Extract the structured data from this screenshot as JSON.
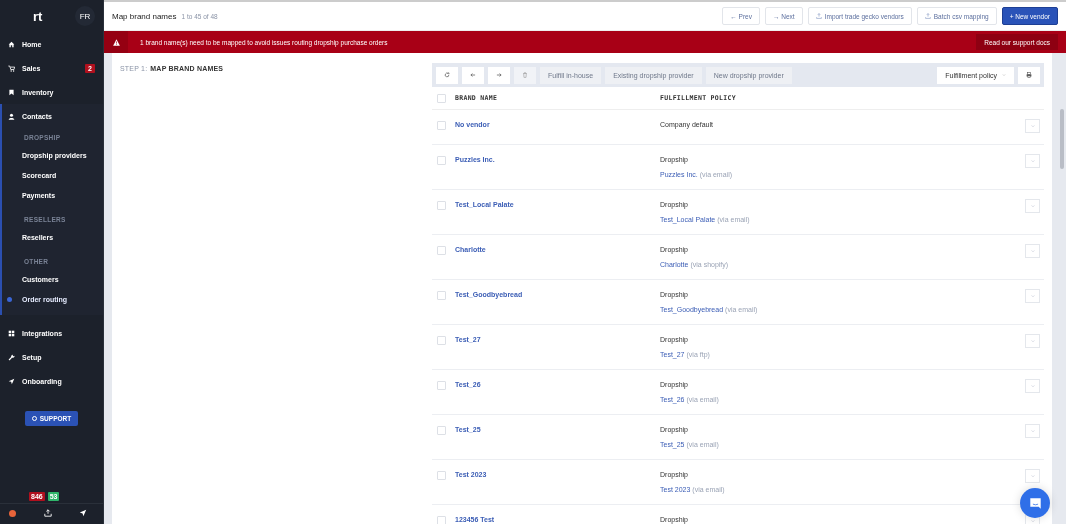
{
  "app": {
    "logo_text": "rt",
    "language": "FR"
  },
  "sidebar": {
    "items": [
      {
        "label": "Home",
        "selected": false
      },
      {
        "label": "Sales",
        "badge": "2",
        "selected": false
      },
      {
        "label": "Inventory",
        "selected": false
      },
      {
        "label": "Contacts",
        "selected": false,
        "expanded": true,
        "children": [
          {
            "kind": "heading",
            "label": "DROPSHIP"
          },
          {
            "kind": "link",
            "label": "Dropship providers",
            "selected": false
          },
          {
            "kind": "link",
            "label": "Scorecard",
            "selected": false
          },
          {
            "kind": "link",
            "label": "Payments",
            "selected": false
          },
          {
            "kind": "heading",
            "label": "RESELLERS"
          },
          {
            "kind": "link",
            "label": "Resellers",
            "selected": false
          },
          {
            "kind": "heading",
            "label": "OTHER"
          },
          {
            "kind": "link",
            "label": "Customers",
            "selected": false
          },
          {
            "kind": "link",
            "label": "Order routing",
            "selected": true
          }
        ]
      },
      {
        "label": "Integrations",
        "selected": false
      },
      {
        "label": "Setup",
        "selected": false
      },
      {
        "label": "Onboarding",
        "selected": false
      }
    ],
    "support_button": "SUPPORT",
    "counters": [
      {
        "label": "846",
        "color": "#b0101e"
      },
      {
        "label": "53",
        "color": "#2fb56a"
      }
    ]
  },
  "header": {
    "title": "Map brand names",
    "count": "1 to 45 of 48",
    "buttons": [
      {
        "kind": "plain",
        "label": "← Prev"
      },
      {
        "kind": "plain",
        "label": "→ Next"
      },
      {
        "kind": "upload",
        "label": "Import trade gecko vendors"
      },
      {
        "kind": "upload",
        "label": "Batch csv mapping"
      },
      {
        "kind": "primary",
        "label": "+ New vendor"
      }
    ]
  },
  "alert": {
    "message": "1 brand name(s) need to be mapped to avoid issues routing dropship purchase orders",
    "action": "Read our support docs"
  },
  "step": {
    "number": "STEP 1:",
    "title": "MAP BRAND NAMES"
  },
  "toolbar": {
    "buttons": [
      {
        "kind": "refresh"
      },
      {
        "kind": "back"
      },
      {
        "kind": "forward"
      },
      {
        "kind": "delete"
      },
      {
        "kind": "text",
        "label": "Fulfill in-house",
        "disabled": true
      },
      {
        "kind": "text",
        "label": "Existing dropship provider",
        "disabled": true
      },
      {
        "kind": "text",
        "label": "New dropship provider",
        "disabled": true
      }
    ],
    "filter": "Fulfillment policy"
  },
  "table": {
    "select_all": {
      "checked": false
    },
    "columns": [
      "BRAND NAME",
      "FULFILLMENT POLICY"
    ],
    "rows": [
      {
        "name": "No vendor",
        "checked": false,
        "policy": "Company default"
      },
      {
        "name": "Puzzles Inc.",
        "checked": false,
        "policy": "Dropship",
        "provider": "Puzzles Inc.",
        "via": "(via email)"
      },
      {
        "name": "Test_Local Palate",
        "checked": false,
        "policy": "Dropship",
        "provider": "Test_Local Palate",
        "via": "(via email)"
      },
      {
        "name": "Charlotte",
        "checked": false,
        "policy": "Dropship",
        "provider": "Charlotte",
        "via": "(via shopify)"
      },
      {
        "name": "Test_Goodbyebread",
        "checked": false,
        "policy": "Dropship",
        "provider": "Test_Goodbyebread",
        "via": "(via email)"
      },
      {
        "name": "Test_27",
        "checked": false,
        "policy": "Dropship",
        "provider": "Test_27",
        "via": "(via ftp)"
      },
      {
        "name": "Test_26",
        "checked": false,
        "policy": "Dropship",
        "provider": "Test_26",
        "via": "(via email)"
      },
      {
        "name": "Test_25",
        "checked": false,
        "policy": "Dropship",
        "provider": "Test_25",
        "via": "(via email)"
      },
      {
        "name": "Test 2023",
        "checked": false,
        "policy": "Dropship",
        "provider": "Test 2023",
        "via": "(via email)"
      },
      {
        "name": "123456 Test",
        "checked": false,
        "policy": "Dropship"
      }
    ]
  }
}
